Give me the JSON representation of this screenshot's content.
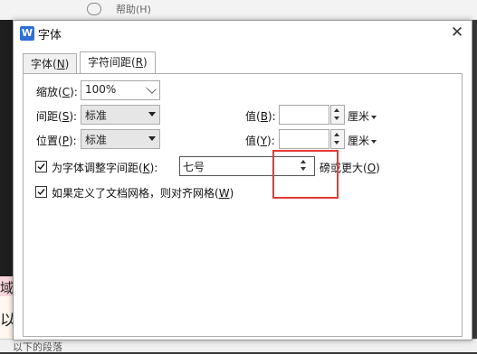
{
  "background": {
    "help_text": "帮助(H)",
    "bottom_text": "以下的段落",
    "left_chars": [
      "域",
      "以"
    ]
  },
  "dialog": {
    "title": "字体",
    "app_icon": "W",
    "close_glyph": "✕",
    "tabs": [
      {
        "label_main": "字体(",
        "label_key": "N",
        "label_end": ")",
        "active": false
      },
      {
        "label_main": "字符间距(",
        "label_key": "R",
        "label_end": ")",
        "active": true
      }
    ],
    "scale": {
      "label_main": "缩放(",
      "label_key": "C",
      "label_end": "):",
      "value": "100%"
    },
    "spacing": {
      "label_main": "间距(",
      "label_key": "S",
      "label_end": "):",
      "value": "标准",
      "by_label_main": "值(",
      "by_label_key": "B",
      "by_label_end": "):",
      "by_value": "",
      "unit": "厘米"
    },
    "position": {
      "label_main": "位置(",
      "label_key": "P",
      "label_end": "):",
      "value": "标准",
      "by_label_main": "值(",
      "by_label_key": "Y",
      "by_label_end": "):",
      "by_value": "",
      "unit": "厘米"
    },
    "kerning": {
      "checked": true,
      "label_main": "为字体调整字间距(",
      "label_key": "K",
      "label_end": "):",
      "value": "七号",
      "suffix_main": "磅或更大(",
      "suffix_key": "O",
      "suffix_end": ")"
    },
    "snap_to_grid": {
      "checked": true,
      "label_main": "如果定义了文档网格，则对齐网格(",
      "label_key": "W",
      "label_end": ")"
    }
  },
  "colors": {
    "accent": "#2f6fd6",
    "highlight_box": "#e53935"
  }
}
